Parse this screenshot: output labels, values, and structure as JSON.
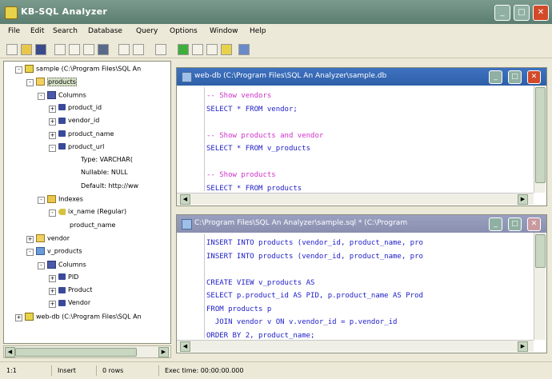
{
  "app": {
    "title": "KB-SQL Analyzer"
  },
  "menu": [
    "File",
    "Edit",
    "Search",
    "Database",
    "Query",
    "Options",
    "Window",
    "Help"
  ],
  "tree": {
    "nodes": [
      {
        "label": "sample (C:\\Program Files\\SQL An",
        "depth": 0,
        "icon": "database-icon",
        "exp": "-"
      },
      {
        "label": "products",
        "depth": 1,
        "icon": "table-icon",
        "exp": "-",
        "selected": true
      },
      {
        "label": "Columns",
        "depth": 2,
        "icon": "columns-icon",
        "exp": "-"
      },
      {
        "label": "product_id",
        "depth": 3,
        "icon": "column-icon",
        "exp": "+"
      },
      {
        "label": "vendor_id",
        "depth": 3,
        "icon": "column-icon",
        "exp": "+"
      },
      {
        "label": "product_name",
        "depth": 3,
        "icon": "column-icon",
        "exp": "+"
      },
      {
        "label": "product_url",
        "depth": 3,
        "icon": "column-icon",
        "exp": "-"
      },
      {
        "label": "Type: VARCHAR(",
        "depth": 5,
        "icon": "none",
        "exp": ""
      },
      {
        "label": "Nullable: NULL",
        "depth": 5,
        "icon": "none",
        "exp": ""
      },
      {
        "label": "Default: http://ww",
        "depth": 5,
        "icon": "none",
        "exp": ""
      },
      {
        "label": "Indexes",
        "depth": 2,
        "icon": "folder-icon",
        "exp": "-"
      },
      {
        "label": "ix_name (Regular)",
        "depth": 3,
        "icon": "key-icon",
        "exp": "-"
      },
      {
        "label": "product_name",
        "depth": 4,
        "icon": "none",
        "exp": ""
      },
      {
        "label": "vendor",
        "depth": 1,
        "icon": "table-icon",
        "exp": "+"
      },
      {
        "label": "v_products",
        "depth": 1,
        "icon": "view-icon",
        "exp": "-"
      },
      {
        "label": "Columns",
        "depth": 2,
        "icon": "columns-icon",
        "exp": "-"
      },
      {
        "label": "PID",
        "depth": 3,
        "icon": "column-icon",
        "exp": "+"
      },
      {
        "label": "Product",
        "depth": 3,
        "icon": "column-icon",
        "exp": "+"
      },
      {
        "label": "Vendor",
        "depth": 3,
        "icon": "column-icon",
        "exp": "+"
      },
      {
        "label": "web-db (C:\\Program Files\\SQL An",
        "depth": 0,
        "icon": "database-icon",
        "exp": "+"
      }
    ]
  },
  "doc1": {
    "title": "web-db (C:\\Program Files\\SQL An Analyzer\\sample.db",
    "lines": [
      {
        "text": "-- Show vendors",
        "cls": "cm"
      },
      {
        "text": "SELECT * FROM vendor;",
        "cls": "kw"
      },
      {
        "text": "",
        "cls": ""
      },
      {
        "text": "-- Show products and vendor",
        "cls": "cm"
      },
      {
        "text": "SELECT * FROM v_products",
        "cls": "kw"
      },
      {
        "text": "",
        "cls": ""
      },
      {
        "text": "-- Show products",
        "cls": "cm"
      },
      {
        "text": "SELECT * FROM products",
        "cls": "kw"
      }
    ]
  },
  "doc2": {
    "title": "C:\\Program Files\\SQL An Analyzer\\sample.sql * (C:\\Program",
    "lines": [
      {
        "text": "INSERT INTO products (vendor_id, product_name, pro",
        "cls": "kw"
      },
      {
        "text": "INSERT INTO products (vendor_id, product_name, pro",
        "cls": "kw"
      },
      {
        "text": "",
        "cls": ""
      },
      {
        "text": "CREATE VIEW v_products AS",
        "cls": "kw"
      },
      {
        "text": "SELECT p.product_id AS PID, p.product_name AS Prod",
        "cls": "kw"
      },
      {
        "text": "FROM products p",
        "cls": "kw"
      },
      {
        "text": "  JOIN vendor v ON v.vendor_id = p.vendor_id",
        "cls": "kw"
      },
      {
        "text": "ORDER BY 2, product_name;",
        "cls": "kw"
      }
    ]
  },
  "status": {
    "position": "1:1",
    "mode": "Insert",
    "state": "0 rows",
    "elapsed": "Exec time: 00:00:00.000"
  },
  "colors": {
    "titlebar": "#5c7e70",
    "doc_title_active": "#2f5fa8",
    "doc_title_inactive": "#8a8fb0",
    "keyword": "#1c1cc8",
    "comment": "#d030c8"
  }
}
